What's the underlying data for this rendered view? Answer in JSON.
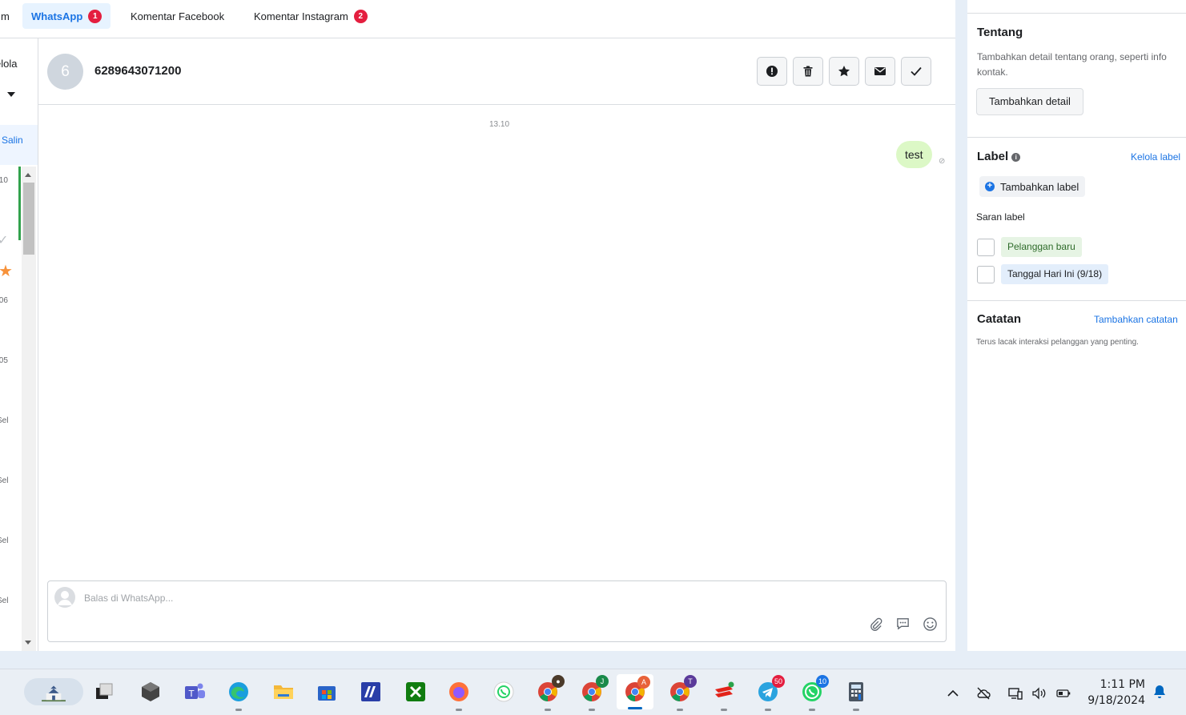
{
  "tabs": {
    "cut_label": "m",
    "whatsapp": {
      "label": "WhatsApp",
      "badge": "1"
    },
    "facebook": {
      "label": "Komentar Facebook"
    },
    "instagram": {
      "label": "Komentar Instagram",
      "badge": "2"
    }
  },
  "list": {
    "kelola": "elola",
    "salin": "Salin",
    "items": [
      ".10",
      ".06",
      ".05",
      "Sel",
      "Sel",
      "Sel",
      "Sel"
    ]
  },
  "conversation": {
    "avatar_initial": "6",
    "contact": "6289643071200",
    "time": "13.10",
    "message": "test",
    "composer_placeholder": "Balas di WhatsApp..."
  },
  "side": {
    "about_title": "Tentang",
    "about_desc": "Tambahkan detail tentang orang, seperti info kontak.",
    "add_detail": "Tambahkan detail",
    "label_title": "Label",
    "manage_labels": "Kelola label",
    "add_label": "Tambahkan label",
    "suggest_title": "Saran label",
    "suggestions": [
      "Pelanggan baru",
      "Tanggal Hari Ini (9/18)"
    ],
    "notes_title": "Catatan",
    "add_note": "Tambahkan catatan",
    "notes_desc": "Terus lacak interaksi pelanggan yang penting."
  },
  "taskbar": {
    "badges": {
      "chrome_j": "J",
      "chrome_a": "A",
      "chrome_t": "T",
      "telegram": "50",
      "whatsapp": "10"
    },
    "time": "1:11 PM",
    "date": "9/18/2024"
  },
  "colors": {
    "accent": "#1b74e4",
    "badge": "#e41e3f",
    "bubble": "#dcf8c6"
  }
}
